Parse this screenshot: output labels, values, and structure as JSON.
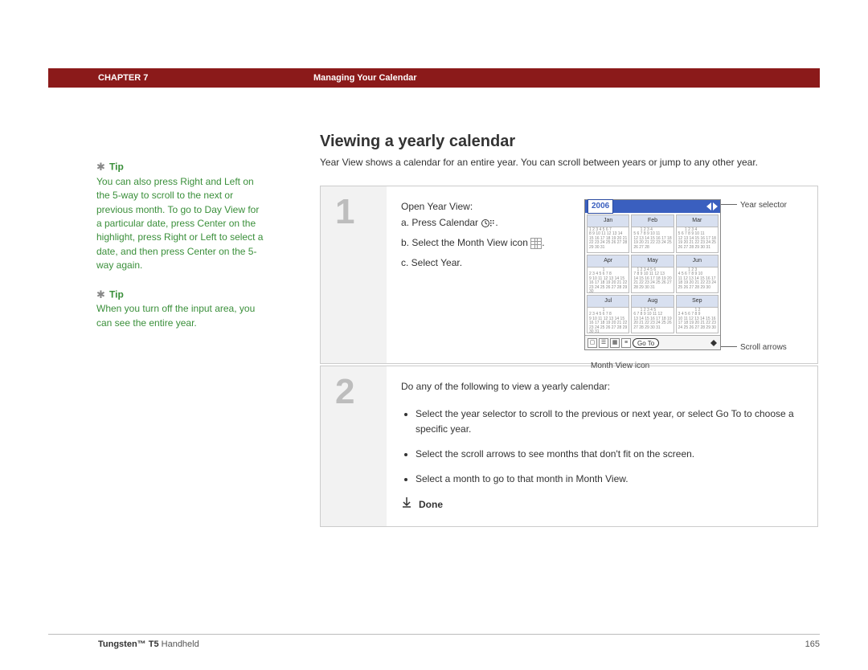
{
  "header": {
    "chapter": "CHAPTER 7",
    "title": "Managing Your Calendar"
  },
  "sidebar": {
    "tips": [
      {
        "label": "Tip",
        "body": "You can also press Right and Left on the 5-way to scroll to the next or previous month. To go to Day View for a particular date, press Center on the highlight, press Right or Left to select a date, and then press Center on the 5-way again."
      },
      {
        "label": "Tip",
        "body": "When you turn off the input area, you can see the entire year."
      }
    ]
  },
  "main": {
    "heading": "Viewing a yearly calendar",
    "intro": "Year View shows a calendar for an entire year. You can scroll between years or jump to any other year.",
    "step1": {
      "num": "1",
      "lead": "Open Year View:",
      "a_pre": "a.  Press Calendar ",
      "a_post": ".",
      "b_pre": "b.  Select the Month View icon ",
      "b_post": ".",
      "c": "c.  Select Year."
    },
    "step2": {
      "num": "2",
      "lead": "Do any of the following to view a yearly calendar:",
      "bullets": [
        "Select the year selector to scroll to the previous or next year, or select Go To to choose a specific year.",
        "Select the scroll arrows to see months that don't fit on the screen.",
        "Select a month to go to that month in Month View."
      ],
      "done": "Done"
    },
    "figure": {
      "year": "2006",
      "months": [
        "Jan",
        "Feb",
        "Mar",
        "Apr",
        "May",
        "Jun",
        "Jul",
        "Aug",
        "Sep"
      ],
      "goto": "Go To",
      "callouts": {
        "year_selector": "Year selector",
        "scroll_arrows": "Scroll arrows",
        "month_view_icon": "Month View icon"
      }
    }
  },
  "footer": {
    "product_bold": "Tungsten™ T5",
    "product_rest": " Handheld",
    "page": "165"
  }
}
